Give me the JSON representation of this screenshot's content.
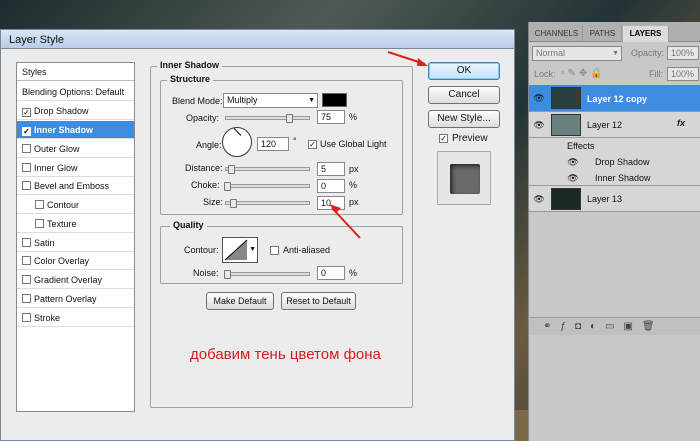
{
  "dialog": {
    "title": "Layer Style",
    "styles_header": "Styles",
    "style_items": [
      {
        "label": "Blending Options: Default",
        "checked": null
      },
      {
        "label": "Drop Shadow",
        "checked": true
      },
      {
        "label": "Inner Shadow",
        "checked": true,
        "selected": true
      },
      {
        "label": "Outer Glow",
        "checked": false
      },
      {
        "label": "Inner Glow",
        "checked": false
      },
      {
        "label": "Bevel and Emboss",
        "checked": false
      },
      {
        "label": "Contour",
        "checked": false,
        "sub": true
      },
      {
        "label": "Texture",
        "checked": false,
        "sub": true
      },
      {
        "label": "Satin",
        "checked": false
      },
      {
        "label": "Color Overlay",
        "checked": false
      },
      {
        "label": "Gradient Overlay",
        "checked": false
      },
      {
        "label": "Pattern Overlay",
        "checked": false
      },
      {
        "label": "Stroke",
        "checked": false
      }
    ],
    "section_title": "Inner Shadow",
    "structure": {
      "title": "Structure",
      "blend_mode_label": "Blend Mode:",
      "blend_mode_value": "Multiply",
      "shadow_color": "#000000",
      "opacity_label": "Opacity:",
      "opacity_value": "75",
      "angle_label": "Angle:",
      "angle_value": "120",
      "degree_symbol": "°",
      "use_global_light_label": "Use Global Light",
      "distance_label": "Distance:",
      "distance_value": "5",
      "choke_label": "Choke:",
      "choke_value": "0",
      "size_label": "Size:",
      "size_value": "10",
      "unit_percent": "%",
      "unit_px": "px"
    },
    "quality": {
      "title": "Quality",
      "contour_label": "Contour:",
      "anti_aliased_label": "Anti-aliased",
      "noise_label": "Noise:",
      "noise_value": "0",
      "unit_percent": "%"
    },
    "make_default": "Make Default",
    "reset_default": "Reset to Default",
    "ok": "OK",
    "cancel": "Cancel",
    "new_style": "New Style...",
    "preview": "Preview"
  },
  "annotation": "добавим тень цветом фона",
  "layers_panel": {
    "tabs": [
      "CHANNELS",
      "PATHS",
      "LAYERS"
    ],
    "blend_mode": "Normal",
    "opacity_label": "Opacity:",
    "opacity_value": "100%",
    "lock_label": "Lock:",
    "fill_label": "Fill:",
    "fill_value": "100%",
    "layers": [
      {
        "name": "Layer 12 copy",
        "selected": true
      },
      {
        "name": "Layer 12",
        "fx": "fx"
      },
      {
        "name": "Effects",
        "effect": true
      },
      {
        "name": "Drop Shadow",
        "effect": true
      },
      {
        "name": "Inner Shadow",
        "effect": true
      },
      {
        "name": "Layer 13"
      }
    ]
  }
}
